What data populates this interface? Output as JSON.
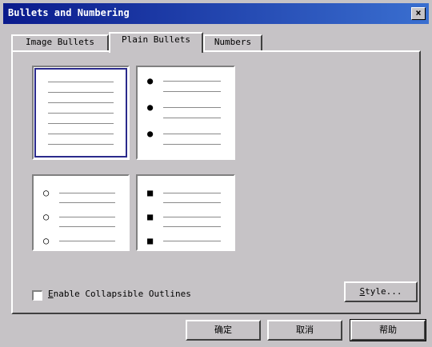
{
  "window": {
    "title": "Bullets and Numbering",
    "close_glyph": "×"
  },
  "tabs": [
    {
      "label": "Image Bullets",
      "active": false
    },
    {
      "label": "Plain Bullets",
      "active": true
    },
    {
      "label": "Numbers",
      "active": false
    }
  ],
  "bullet_styles": [
    {
      "name": "none",
      "glyph": "",
      "selected": true
    },
    {
      "name": "filled-circle",
      "glyph": "●",
      "selected": false
    },
    {
      "name": "hollow-circle",
      "glyph": "○",
      "selected": false
    },
    {
      "name": "filled-square",
      "glyph": "■",
      "selected": false
    }
  ],
  "options": {
    "collapsible_checkbox_checked": false,
    "collapsible_label_mnemonic": "E",
    "collapsible_label_rest": "nable Collapsible Outlines",
    "style_button_mnemonic": "S",
    "style_button_rest": "tyle..."
  },
  "footer": {
    "ok_label": "确定",
    "cancel_label": "取消",
    "help_label": "帮助"
  }
}
